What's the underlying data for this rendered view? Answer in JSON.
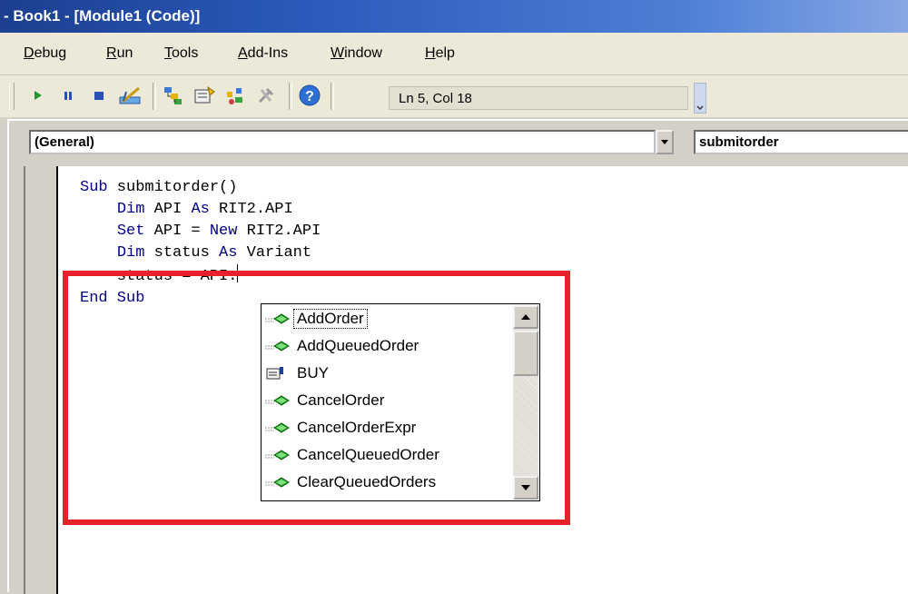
{
  "window": {
    "title": "- Book1 - [Module1 (Code)]"
  },
  "menu": [
    {
      "label": "Debug",
      "u": "D",
      "rest": "ebug"
    },
    {
      "label": "Run",
      "u": "R",
      "rest": "un"
    },
    {
      "label": "Tools",
      "u": "T",
      "rest": "ools"
    },
    {
      "label": "Add-Ins",
      "u": "A",
      "rest": "dd-Ins"
    },
    {
      "label": "Window",
      "u": "W",
      "rest": "indow"
    },
    {
      "label": "Help",
      "u": "H",
      "rest": "elp"
    }
  ],
  "toolbar": {
    "status": "Ln 5, Col 18",
    "icons": [
      "run-icon",
      "pause-icon",
      "stop-icon",
      "design-mode-icon",
      "project-explorer-icon",
      "properties-icon",
      "object-browser-icon",
      "toolbox-icon",
      "help-icon"
    ]
  },
  "code_window": {
    "object_combo": "(General)",
    "procedure_combo": "submitorder"
  },
  "code": {
    "line1": {
      "kw": "Sub",
      "rest": " submitorder()"
    },
    "line2": {
      "indent": "    ",
      "kw1": "Dim",
      "mid": " API ",
      "kw2": "As",
      "rest": " RIT2.API"
    },
    "line3": {
      "indent": "    ",
      "kw1": "Set",
      "mid": " API = ",
      "kw2": "New",
      "rest": " RIT2.API"
    },
    "line4": {
      "indent": "    ",
      "kw1": "Dim",
      "mid": " status ",
      "kw2": "As",
      "rest": " Variant"
    },
    "line5": {
      "text": "    status = API."
    },
    "line6": {
      "kw": "End Sub"
    }
  },
  "intellisense": {
    "items": [
      {
        "label": "AddOrder",
        "icon": "method-icon",
        "selected": true
      },
      {
        "label": "AddQueuedOrder",
        "icon": "method-icon"
      },
      {
        "label": "BUY",
        "icon": "property-icon"
      },
      {
        "label": "CancelOrder",
        "icon": "method-icon"
      },
      {
        "label": "CancelOrderExpr",
        "icon": "method-icon"
      },
      {
        "label": "CancelQueuedOrder",
        "icon": "method-icon"
      },
      {
        "label": "ClearQueuedOrders",
        "icon": "method-icon"
      }
    ]
  },
  "colors": {
    "keyword": "#00008b",
    "highlight": "#e8202a",
    "title_bar": "#2b5bbd"
  }
}
